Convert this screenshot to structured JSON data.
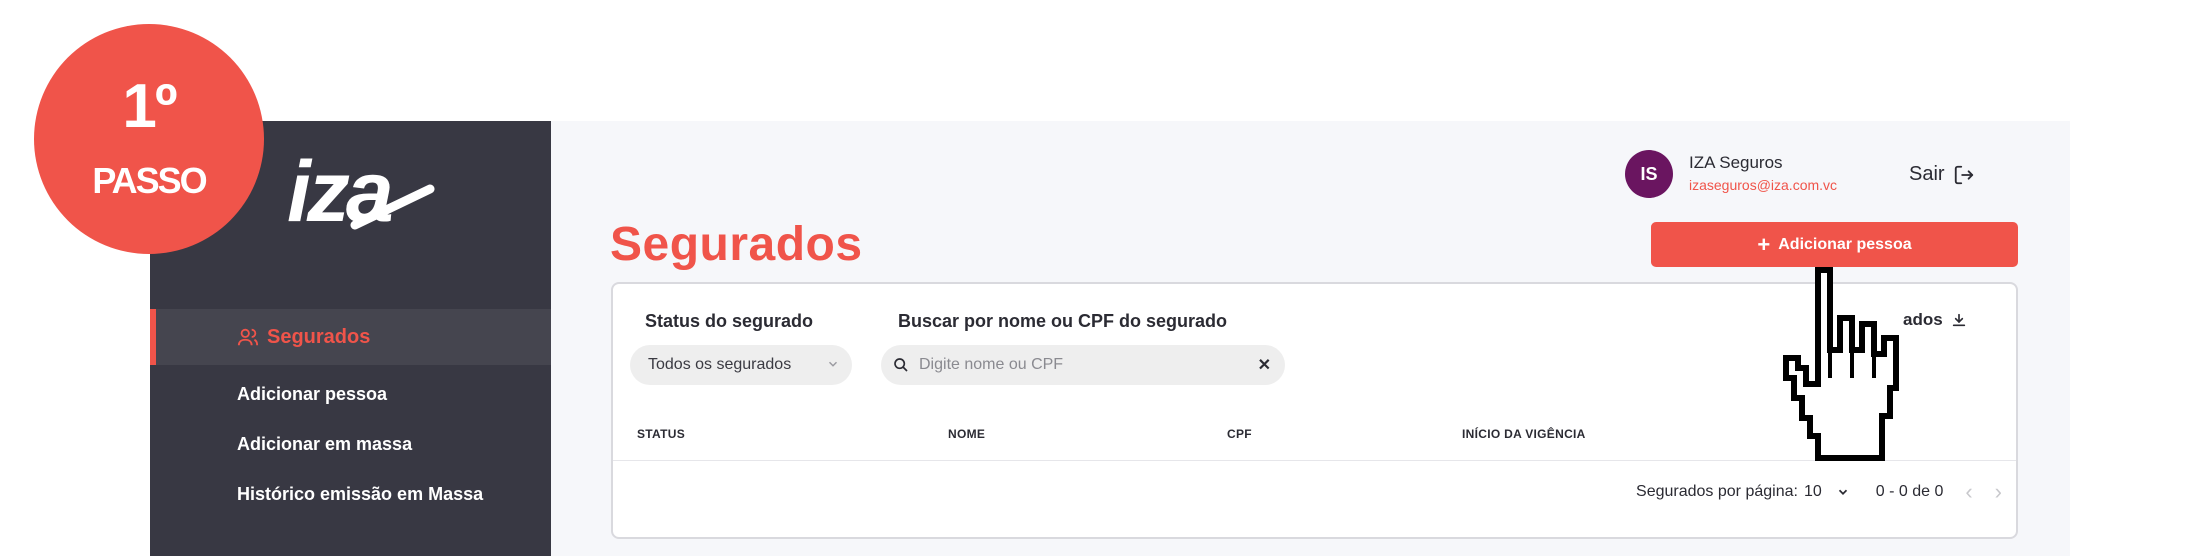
{
  "badge": {
    "number": "1º",
    "word": "PASSO"
  },
  "brand": {
    "logo_text": "iza"
  },
  "sidebar": {
    "items": [
      {
        "label": "Segurados",
        "active": true
      },
      {
        "label": "Adicionar pessoa"
      },
      {
        "label": "Adicionar em massa"
      },
      {
        "label": "Histórico emissão em Massa"
      }
    ]
  },
  "user": {
    "initials": "IS",
    "name": "IZA Seguros",
    "email": "izaseguros@iza.com.vc"
  },
  "header": {
    "logout_label": "Sair"
  },
  "page": {
    "title": "Segurados",
    "add_button": "Adicionar pessoa"
  },
  "filters": {
    "status_label": "Status do segurado",
    "status_value": "Todos os segurados",
    "search_label": "Buscar por nome ou CPF do segurado",
    "search_placeholder": "Digite nome ou CPF",
    "export_label": "ados"
  },
  "table": {
    "columns": [
      "STATUS",
      "NOME",
      "CPF",
      "INÍCIO DA VIGÊNCIA"
    ]
  },
  "pagination": {
    "rows_label": "Segurados por página:",
    "rows_value": "10",
    "range": "0 - 0 de 0"
  },
  "colors": {
    "accent": "#f0544a",
    "sidebar": "#383843",
    "avatar": "#6a1560"
  }
}
